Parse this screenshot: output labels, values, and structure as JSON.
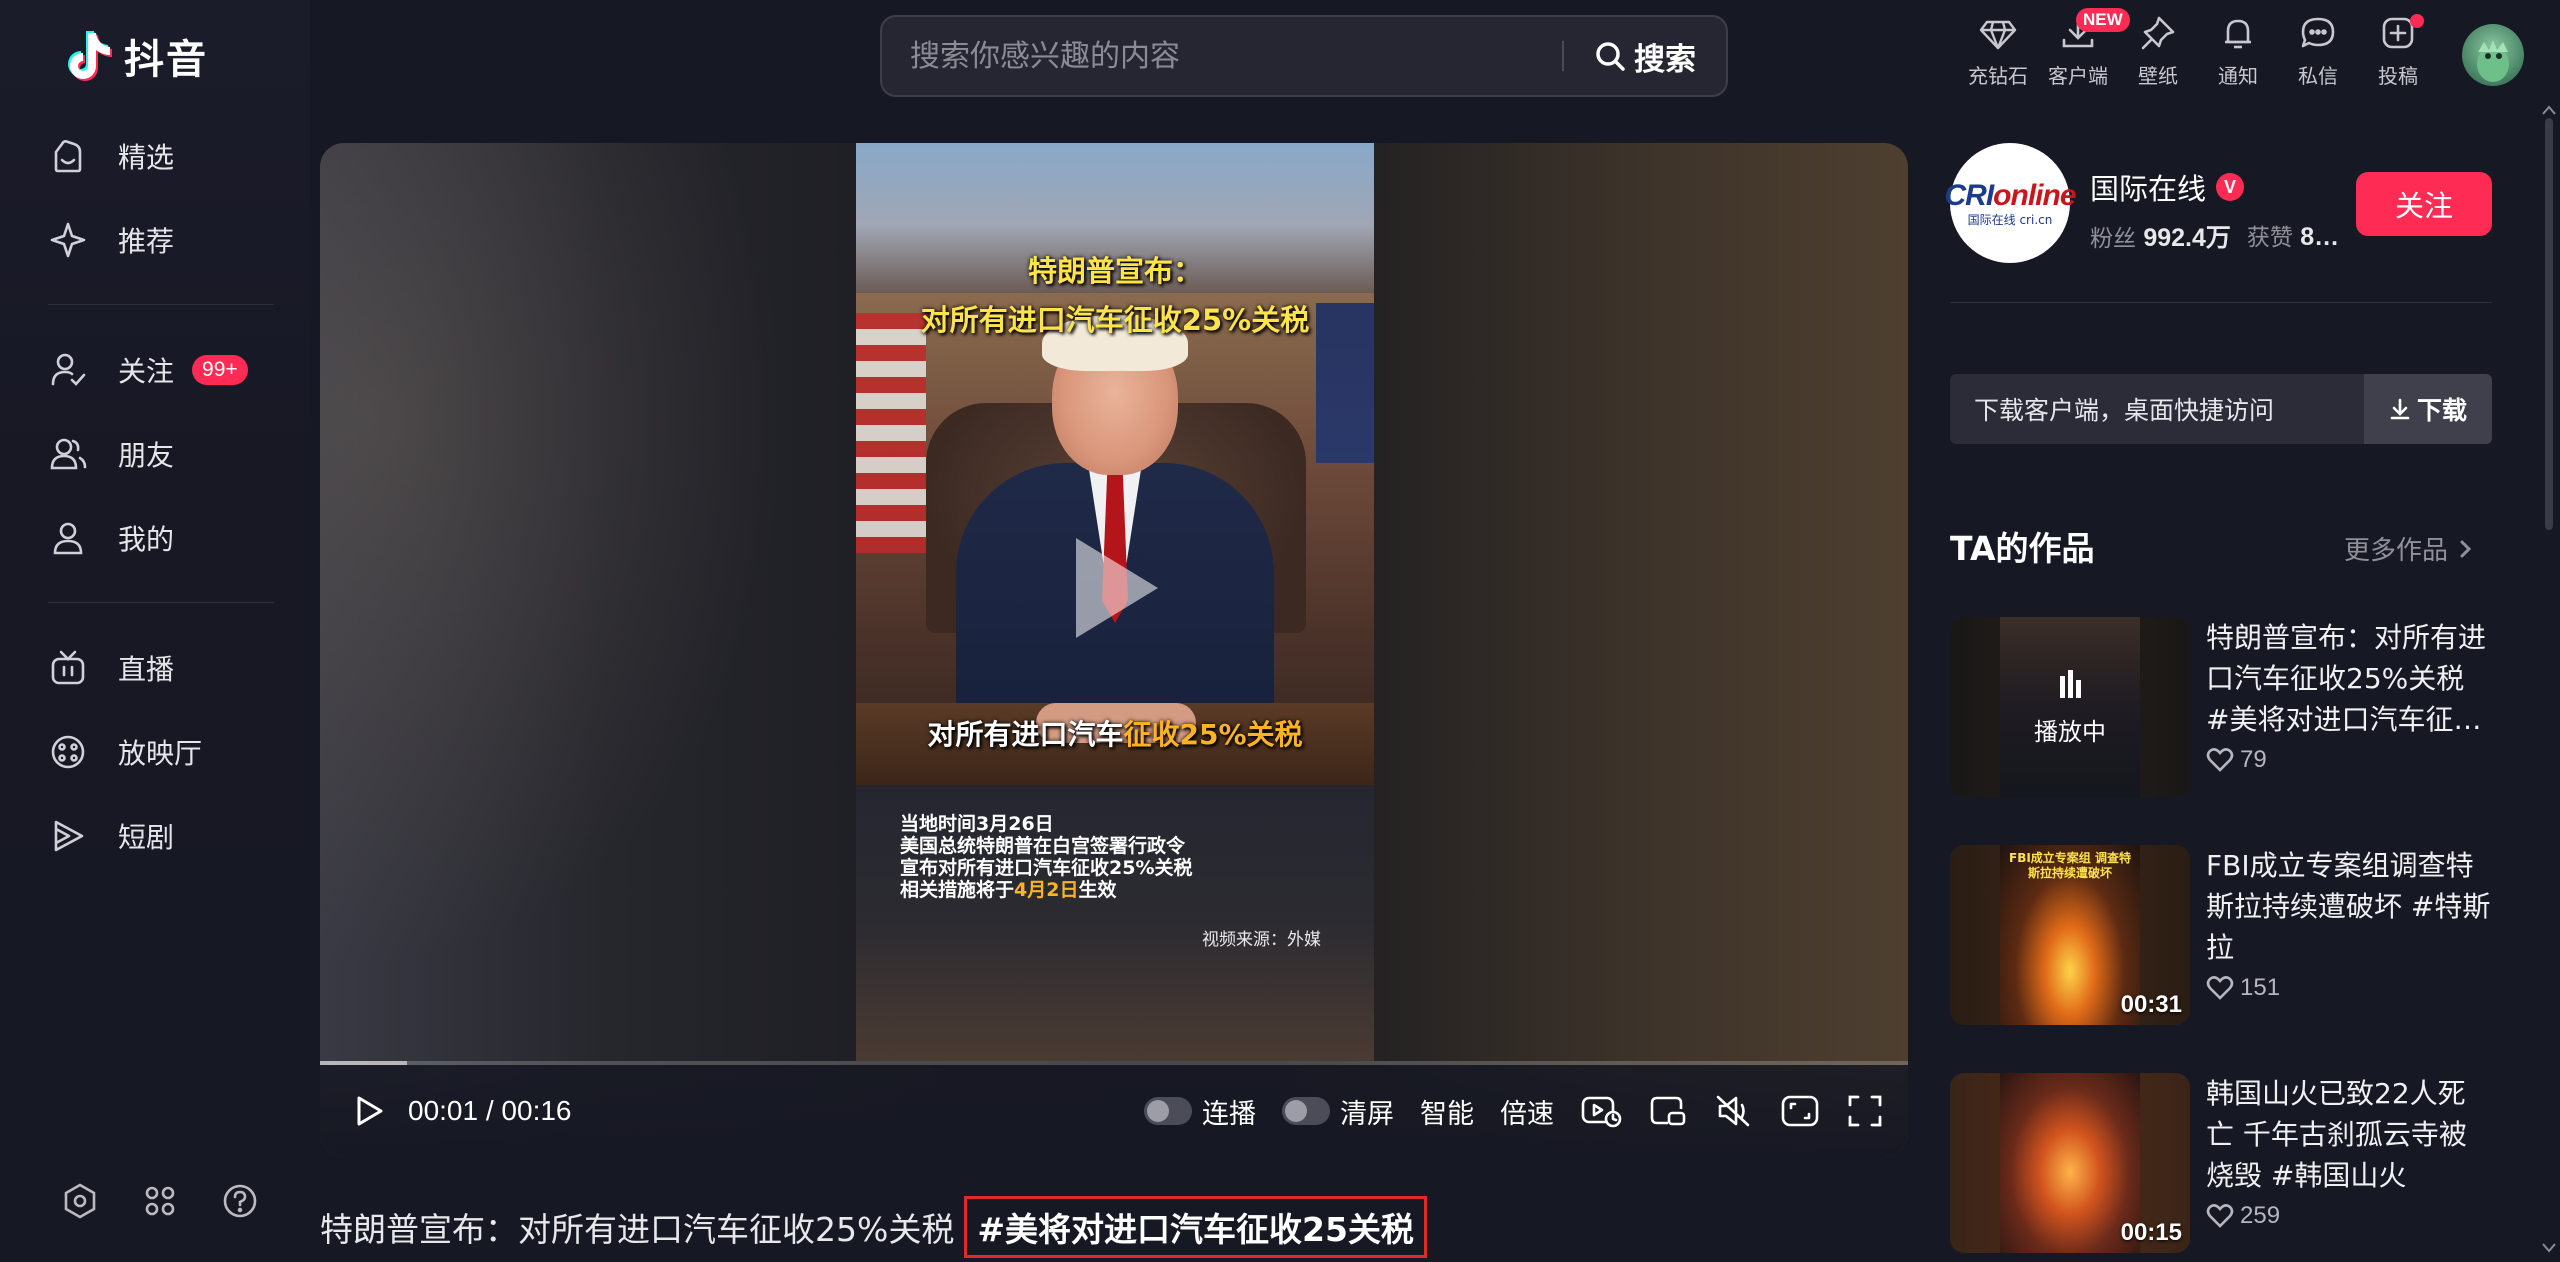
{
  "app": {
    "name": "抖音"
  },
  "sidebar": {
    "items": [
      {
        "label": "精选",
        "icon": "smiley-home-icon"
      },
      {
        "label": "推荐",
        "icon": "sparkle-icon"
      },
      {
        "label": "关注",
        "icon": "user-check-icon",
        "badge": "99+"
      },
      {
        "label": "朋友",
        "icon": "friends-icon"
      },
      {
        "label": "我的",
        "icon": "person-icon"
      },
      {
        "label": "直播",
        "icon": "tv-icon"
      },
      {
        "label": "放映厅",
        "icon": "film-reel-icon"
      },
      {
        "label": "短剧",
        "icon": "play-stack-icon"
      }
    ],
    "footer_icons": [
      "settings-hexagon-icon",
      "apps-grid-icon",
      "help-icon"
    ]
  },
  "search": {
    "placeholder": "搜索你感兴趣的内容",
    "button_label": "搜索"
  },
  "top_actions": [
    {
      "label": "充钻石",
      "icon": "diamond-icon"
    },
    {
      "label": "客户端",
      "icon": "download-icon",
      "badge": "NEW"
    },
    {
      "label": "壁纸",
      "icon": "pin-icon"
    },
    {
      "label": "通知",
      "icon": "bell-icon"
    },
    {
      "label": "私信",
      "icon": "message-icon"
    },
    {
      "label": "投稿",
      "icon": "upload-plus-icon",
      "dot": true
    }
  ],
  "video": {
    "overlay_title_1": "特朗普宣布：",
    "overlay_title_2": "对所有进口汽车征收25%关税",
    "subtitle_plain": "对所有进口汽车",
    "subtitle_highlight": "征收25%关税",
    "info_lines": [
      "当地时间3月26日",
      "美国总统特朗普在白宫签署行政令",
      "宣布对所有进口汽车征收25%关税"
    ],
    "info_last_prefix": "相关措施将于",
    "info_last_highlight": "4月2日",
    "info_last_suffix": "生效",
    "source": "视频来源：外媒",
    "progress": 0.055
  },
  "controls": {
    "current_time": "00:01",
    "separator": "/",
    "duration": "00:16",
    "autoplay_label": "连播",
    "clear_label": "清屏",
    "smart_label": "智能",
    "speed_label": "倍速"
  },
  "caption": {
    "text": "特朗普宣布：对所有进口汽车征收25%关税",
    "hashtag": "#美将对进口汽车征收25关税"
  },
  "author": {
    "name": "国际在线",
    "verified": "V",
    "logo_text_1": "CRI",
    "logo_text_2": "online",
    "logo_sub": "国际在线 cri.cn",
    "fans_label": "粉丝",
    "fans_value": "992.4万",
    "likes_label": "获赞",
    "likes_value": "8…",
    "follow_label": "关注"
  },
  "download_bar": {
    "text": "下载客户端，桌面快捷访问",
    "button_label": "下载"
  },
  "works": {
    "title": "TA的作品",
    "more_label": "更多作品",
    "items": [
      {
        "title": "特朗普宣布：对所有进口汽车征收25%关税 #美将对进口汽车征收…",
        "likes": "79",
        "status": "播放中"
      },
      {
        "title": "FBI成立专案组调查特斯拉持续遭破坏 #特斯拉",
        "likes": "151",
        "duration": "00:31",
        "thumb_text": "FBI成立专案组 调查特斯拉持续遭破坏"
      },
      {
        "title": "韩国山火已致22人死亡 千年古刹孤云寺被烧毁 #韩国山火",
        "likes": "259",
        "duration": "00:15"
      }
    ]
  },
  "colors": {
    "accent": "#fe2c55",
    "background": "#161823",
    "highlight": "#ffb323",
    "title_yellow": "#ffe34a"
  }
}
